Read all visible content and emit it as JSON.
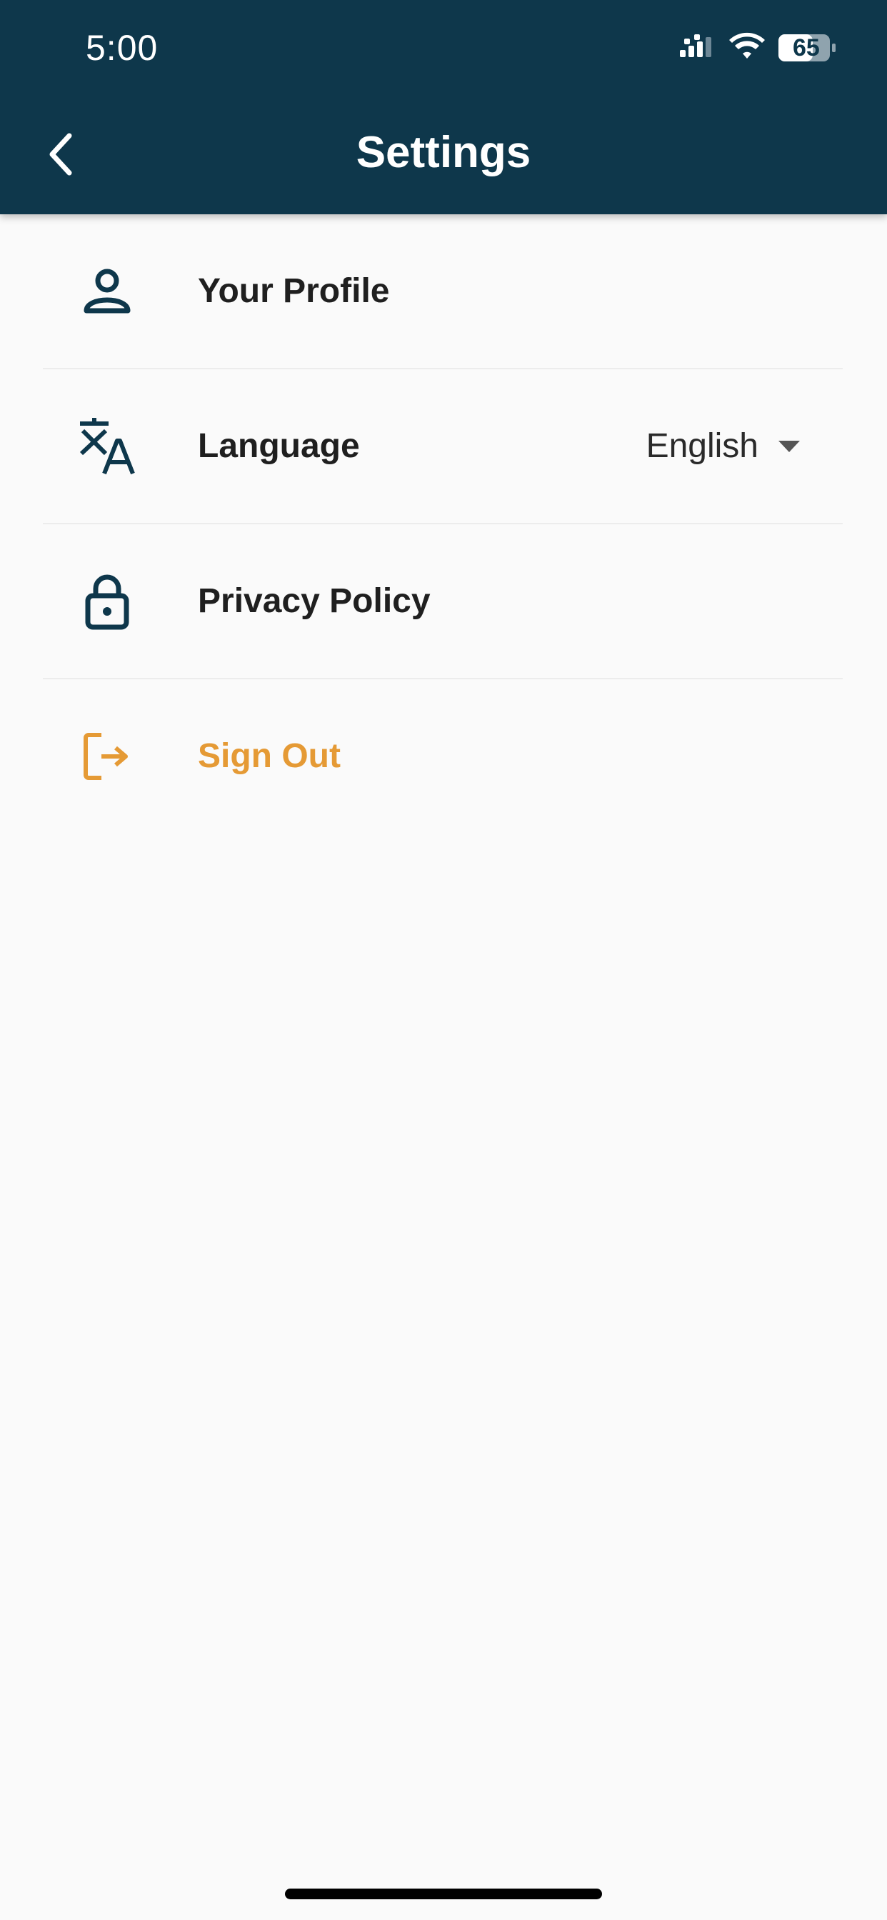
{
  "status_bar": {
    "time": "5:00",
    "battery": "65"
  },
  "header": {
    "title": "Settings"
  },
  "settings": {
    "items": [
      {
        "label": "Your Profile",
        "icon": "person-icon"
      },
      {
        "label": "Language",
        "icon": "translate-icon",
        "value": "English"
      },
      {
        "label": "Privacy Policy",
        "icon": "lock-icon"
      },
      {
        "label": "Sign Out",
        "icon": "sign-out-icon"
      }
    ]
  },
  "colors": {
    "header_bg": "#0e374b",
    "icon": "#0e374b",
    "accent": "#e59a35",
    "page_bg": "#fafafa"
  }
}
